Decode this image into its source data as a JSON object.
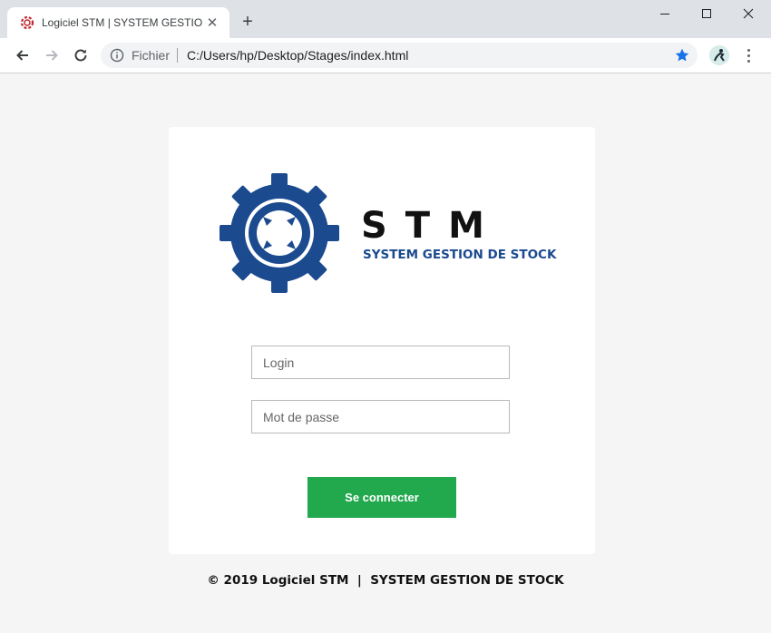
{
  "browser": {
    "tab_title": "Logiciel STM | SYSTEM GESTION",
    "new_tab": "+",
    "address": {
      "scheme_label": "Fichier",
      "url": "C:/Users/hp/Desktop/Stages/index.html"
    }
  },
  "brand": {
    "name": "STM",
    "subtitle": "SYSTEM GESTION DE STOCK",
    "color": "#1b4a8f"
  },
  "form": {
    "login_placeholder": "Login",
    "password_placeholder": "Mot de passe",
    "submit_label": "Se connecter",
    "submit_color": "#22a84d"
  },
  "footer": {
    "text": "© 2019 Logiciel STM  |  SYSTEM GESTION DE STOCK"
  }
}
